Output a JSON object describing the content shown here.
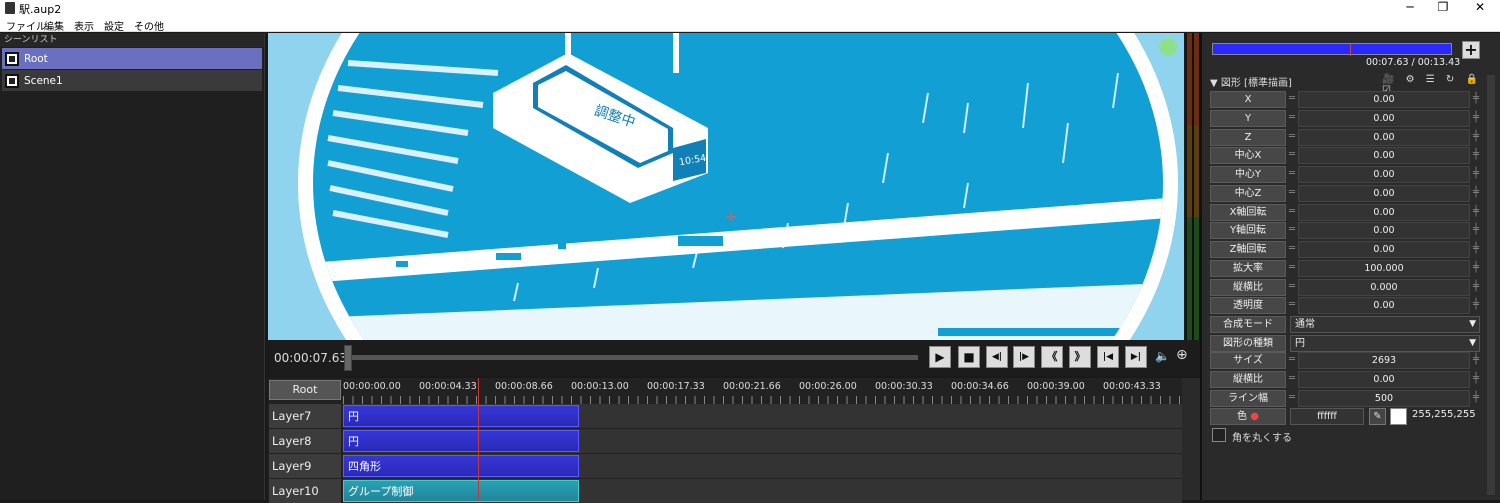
{
  "window": {
    "title": "駅.aup2",
    "minimize": "─",
    "restore": "❐",
    "close": "✕"
  },
  "menu": [
    "ファイル",
    "編集",
    "表示",
    "設定",
    "その他"
  ],
  "scene_list": {
    "header": "シーンリスト",
    "items": [
      {
        "label": "Root",
        "active": true
      },
      {
        "label": "Scene1",
        "active": false
      }
    ]
  },
  "preview": {
    "sign_text": "調整中",
    "clock_text": "10:54"
  },
  "transport": {
    "time": "00:00:07.63",
    "buttons": [
      "▶",
      "■",
      "◀|",
      "|▶",
      "《",
      "》",
      "|◀",
      "▶|"
    ],
    "volume_icon": "🔈",
    "zoom_icon": "⊕"
  },
  "timeline": {
    "root_label": "Root",
    "ruler": [
      "00:00:00.00",
      "00:00:04.33",
      "00:00:08.66",
      "00:00:13.00",
      "00:00:17.33",
      "00:00:21.66",
      "00:00:26.00",
      "00:00:30.33",
      "00:00:34.66",
      "00:00:39.00",
      "00:00:43.33"
    ],
    "layers": [
      {
        "name": "Layer7",
        "clip": "円",
        "style": "blue"
      },
      {
        "name": "Layer8",
        "clip": "円",
        "style": "blue"
      },
      {
        "name": "Layer9",
        "clip": "四角形",
        "style": "blue"
      },
      {
        "name": "Layer10",
        "clip": "グループ制御",
        "style": "teal"
      }
    ]
  },
  "properties": {
    "time_total": "00:07.63 / 00:13.43",
    "add": "+",
    "section": "図形 [標準描画]",
    "header_icons": "🎥 ⚙ ☰ ↻ 🔒 ☑",
    "rows": [
      {
        "label": "X",
        "value": "0.00"
      },
      {
        "label": "Y",
        "value": "0.00"
      },
      {
        "label": "Z",
        "value": "0.00"
      },
      {
        "label": "中心X",
        "value": "0.00"
      },
      {
        "label": "中心Y",
        "value": "0.00"
      },
      {
        "label": "中心Z",
        "value": "0.00"
      },
      {
        "label": "X軸回転",
        "value": "0.00"
      },
      {
        "label": "Y軸回転",
        "value": "0.00"
      },
      {
        "label": "Z軸回転",
        "value": "0.00"
      },
      {
        "label": "拡大率",
        "value": "100.000"
      },
      {
        "label": "縦横比",
        "value": "0.000"
      },
      {
        "label": "透明度",
        "value": "0.00"
      }
    ],
    "blend": {
      "label": "合成モード",
      "value": "通常"
    },
    "shape_type": {
      "label": "図形の種類",
      "value": "円"
    },
    "rows2": [
      {
        "label": "サイズ",
        "value": "2693"
      },
      {
        "label": "縦横比",
        "value": "0.00"
      },
      {
        "label": "ライン幅",
        "value": "500"
      }
    ],
    "color": {
      "label": "色",
      "hex": "ffffff",
      "rgb": "255,255,255",
      "picker_icon": "✎"
    },
    "round": {
      "label": "角を丸くする"
    }
  }
}
